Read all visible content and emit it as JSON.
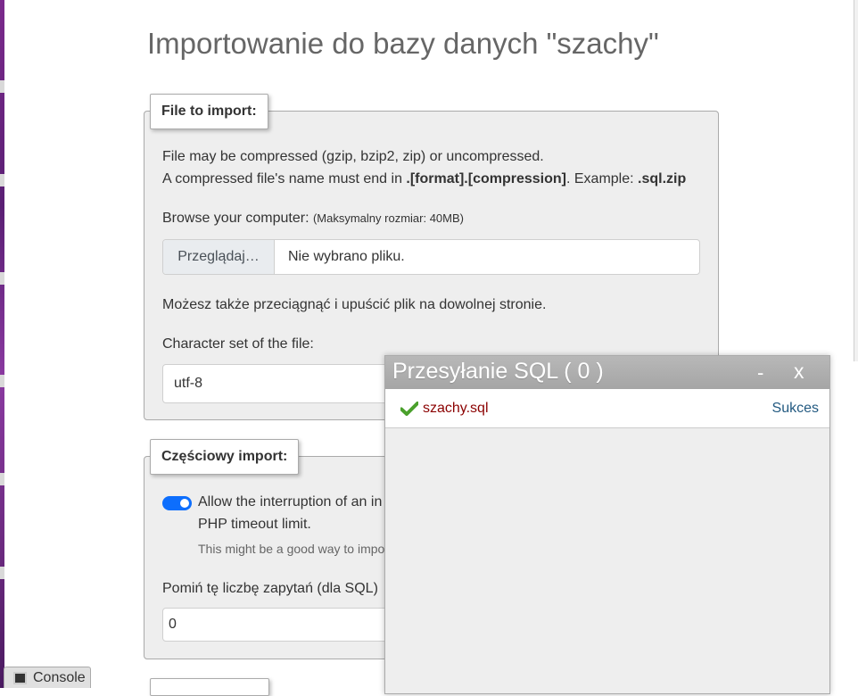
{
  "page": {
    "title": "Importowanie do bazy danych \"szachy\""
  },
  "file_section": {
    "legend": "File to import:",
    "compress_line1": "File may be compressed (gzip, bzip2, zip) or uncompressed.",
    "compress_line2_a": "A compressed file's name must end in ",
    "compress_line2_b": ".[format].[compression]",
    "compress_line2_c": ". Example: ",
    "compress_line2_d": ".sql.zip",
    "browse_label": "Browse your computer:",
    "max_size": "(Maksymalny rozmiar: 40MB)",
    "browse_button": "Przeglądaj…",
    "file_placeholder": "Nie wybrano pliku.",
    "drag_drop_hint": "Możesz także przeciągnąć i upuścić plik na dowolnej stronie.",
    "charset_label": "Character set of the file:",
    "charset_value": "utf-8"
  },
  "partial_section": {
    "legend": "Częściowy import:",
    "allow_interrupt_line1": "Allow the interruption of an in",
    "allow_interrupt_line2": "PHP timeout limit.",
    "allow_interrupt_checked": true,
    "interrupt_note": "This might be a good way to impo",
    "skip_label": "Pomiń tę liczbę zapytań (dla SQL)",
    "skip_value": "0"
  },
  "upload_dialog": {
    "title": "Przesyłanie SQL ( 0 )",
    "minimize": "-",
    "close": "x",
    "file_name": "szachy.sql",
    "status": "Sukces",
    "check_icon": "check-icon"
  },
  "console": {
    "label": "Console"
  },
  "colors": {
    "accent": "#0d6efd",
    "file_link": "#8b0000",
    "status": "#235a81",
    "check": "#4aa02c"
  }
}
